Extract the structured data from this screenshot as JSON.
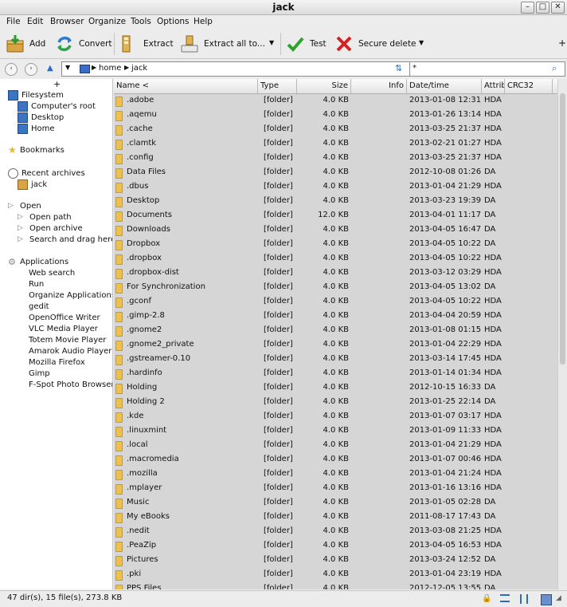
{
  "window": {
    "title": "jack"
  },
  "menu": [
    "File",
    "Edit",
    "Browser",
    "Organize",
    "Tools",
    "Options",
    "Help"
  ],
  "toolbar": {
    "add": "Add",
    "convert": "Convert",
    "extract": "Extract",
    "extract_all": "Extract all to...",
    "test": "Test",
    "secure_delete": "Secure delete"
  },
  "address": {
    "crumb1": "home",
    "crumb2": "jack",
    "filter": "*"
  },
  "sidebar": {
    "filesystem": "Filesystem",
    "computers_root": "Computer's root",
    "desktop": "Desktop",
    "home": "Home",
    "bookmarks": "Bookmarks",
    "recent_archives": "Recent archives",
    "recent_item": "jack",
    "open": "Open",
    "open_path": "Open path",
    "open_archive": "Open archive",
    "search_drag": "Search and drag here",
    "applications": "Applications",
    "apps": [
      "Web search",
      "Run",
      "Organize Applications",
      "gedit",
      "OpenOffice Writer",
      "VLC Media Player",
      "Totem Movie Player",
      "Amarok Audio Player",
      "Mozilla Firefox",
      "Gimp",
      "F-Spot Photo Browser"
    ]
  },
  "columns": {
    "name": "Name <",
    "type": "Type",
    "size": "Size",
    "info": "Info",
    "date": "Date/time",
    "attrib": "Attrib",
    "crc": "CRC32"
  },
  "files": [
    {
      "name": ".adobe",
      "type": "[folder]",
      "size": "4.0 KB",
      "date": "2013-01-08 12:31",
      "attr": "HDA"
    },
    {
      "name": ".aqemu",
      "type": "[folder]",
      "size": "4.0 KB",
      "date": "2013-01-26 13:14",
      "attr": "HDA"
    },
    {
      "name": ".cache",
      "type": "[folder]",
      "size": "4.0 KB",
      "date": "2013-03-25 21:37",
      "attr": "HDA"
    },
    {
      "name": ".clamtk",
      "type": "[folder]",
      "size": "4.0 KB",
      "date": "2013-02-21 01:27",
      "attr": "HDA"
    },
    {
      "name": ".config",
      "type": "[folder]",
      "size": "4.0 KB",
      "date": "2013-03-25 21:37",
      "attr": "HDA"
    },
    {
      "name": "Data Files",
      "type": "[folder]",
      "size": "4.0 KB",
      "date": "2012-10-08 01:26",
      "attr": "DA"
    },
    {
      "name": ".dbus",
      "type": "[folder]",
      "size": "4.0 KB",
      "date": "2013-01-04 21:29",
      "attr": "HDA"
    },
    {
      "name": "Desktop",
      "type": "[folder]",
      "size": "4.0 KB",
      "date": "2013-03-23 19:39",
      "attr": "DA"
    },
    {
      "name": "Documents",
      "type": "[folder]",
      "size": "12.0 KB",
      "date": "2013-04-01 11:17",
      "attr": "DA"
    },
    {
      "name": "Downloads",
      "type": "[folder]",
      "size": "4.0 KB",
      "date": "2013-04-05 16:47",
      "attr": "DA"
    },
    {
      "name": "Dropbox",
      "type": "[folder]",
      "size": "4.0 KB",
      "date": "2013-04-05 10:22",
      "attr": "DA"
    },
    {
      "name": ".dropbox",
      "type": "[folder]",
      "size": "4.0 KB",
      "date": "2013-04-05 10:22",
      "attr": "HDA"
    },
    {
      "name": ".dropbox-dist",
      "type": "[folder]",
      "size": "4.0 KB",
      "date": "2013-03-12 03:29",
      "attr": "HDA"
    },
    {
      "name": "For Synchronization",
      "type": "[folder]",
      "size": "4.0 KB",
      "date": "2013-04-05 13:02",
      "attr": "DA"
    },
    {
      "name": ".gconf",
      "type": "[folder]",
      "size": "4.0 KB",
      "date": "2013-04-05 10:22",
      "attr": "HDA"
    },
    {
      "name": ".gimp-2.8",
      "type": "[folder]",
      "size": "4.0 KB",
      "date": "2013-04-04 20:59",
      "attr": "HDA"
    },
    {
      "name": ".gnome2",
      "type": "[folder]",
      "size": "4.0 KB",
      "date": "2013-01-08 01:15",
      "attr": "HDA"
    },
    {
      "name": ".gnome2_private",
      "type": "[folder]",
      "size": "4.0 KB",
      "date": "2013-01-04 22:29",
      "attr": "HDA"
    },
    {
      "name": ".gstreamer-0.10",
      "type": "[folder]",
      "size": "4.0 KB",
      "date": "2013-03-14 17:45",
      "attr": "HDA"
    },
    {
      "name": ".hardinfo",
      "type": "[folder]",
      "size": "4.0 KB",
      "date": "2013-01-14 01:34",
      "attr": "HDA"
    },
    {
      "name": "Holding",
      "type": "[folder]",
      "size": "4.0 KB",
      "date": "2012-10-15 16:33",
      "attr": "DA"
    },
    {
      "name": "Holding 2",
      "type": "[folder]",
      "size": "4.0 KB",
      "date": "2013-01-25 22:14",
      "attr": "DA"
    },
    {
      "name": ".kde",
      "type": "[folder]",
      "size": "4.0 KB",
      "date": "2013-01-07 03:17",
      "attr": "HDA"
    },
    {
      "name": ".linuxmint",
      "type": "[folder]",
      "size": "4.0 KB",
      "date": "2013-01-09 11:33",
      "attr": "HDA"
    },
    {
      "name": ".local",
      "type": "[folder]",
      "size": "4.0 KB",
      "date": "2013-01-04 21:29",
      "attr": "HDA"
    },
    {
      "name": ".macromedia",
      "type": "[folder]",
      "size": "4.0 KB",
      "date": "2013-01-07 00:46",
      "attr": "HDA"
    },
    {
      "name": ".mozilla",
      "type": "[folder]",
      "size": "4.0 KB",
      "date": "2013-01-04 21:24",
      "attr": "HDA"
    },
    {
      "name": ".mplayer",
      "type": "[folder]",
      "size": "4.0 KB",
      "date": "2013-01-16 13:16",
      "attr": "HDA"
    },
    {
      "name": "Music",
      "type": "[folder]",
      "size": "4.0 KB",
      "date": "2013-01-05 02:28",
      "attr": "DA"
    },
    {
      "name": "My eBooks",
      "type": "[folder]",
      "size": "4.0 KB",
      "date": "2011-08-17 17:43",
      "attr": "DA"
    },
    {
      "name": ".nedit",
      "type": "[folder]",
      "size": "4.0 KB",
      "date": "2013-03-08 21:25",
      "attr": "HDA"
    },
    {
      "name": ".PeaZip",
      "type": "[folder]",
      "size": "4.0 KB",
      "date": "2013-04-05 16:53",
      "attr": "HDA"
    },
    {
      "name": "Pictures",
      "type": "[folder]",
      "size": "4.0 KB",
      "date": "2013-03-24 12:52",
      "attr": "DA"
    },
    {
      "name": ".pki",
      "type": "[folder]",
      "size": "4.0 KB",
      "date": "2013-01-04 23:19",
      "attr": "HDA"
    },
    {
      "name": "PPS Files",
      "type": "[folder]",
      "size": "4.0 KB",
      "date": "2012-12-05 13:55",
      "attr": "DA"
    }
  ],
  "status": "47 dir(s), 15 file(s), 273.8 KB"
}
